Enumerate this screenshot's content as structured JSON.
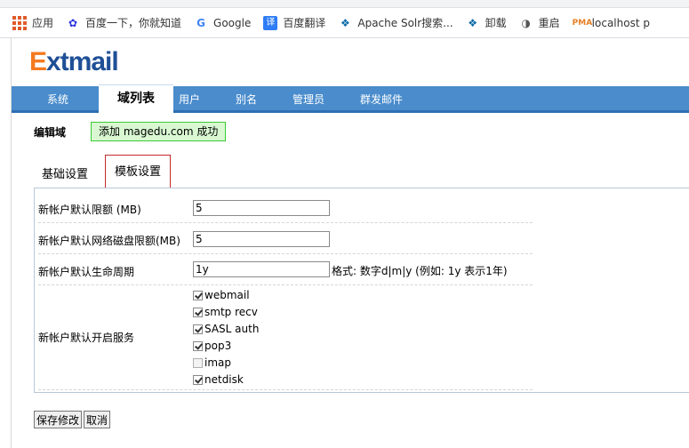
{
  "bookmarks": [
    {
      "icon": "apps-grid-icon",
      "label": "应用"
    },
    {
      "icon": "baidu-paw-icon",
      "label": "百度一下，你就知道"
    },
    {
      "icon": "google-g-icon",
      "label": "Google"
    },
    {
      "icon": "baidu-translate-icon",
      "label": "百度翻译"
    },
    {
      "icon": "drupal-drop-icon",
      "label": "Apache Solr搜索..."
    },
    {
      "icon": "drupal-drop-icon",
      "label": "卸载"
    },
    {
      "icon": "globe-icon",
      "label": "重启"
    },
    {
      "icon": "pma-icon",
      "label": "localhost p"
    }
  ],
  "logo": {
    "e": "E",
    "rest": "xtmail"
  },
  "nav": {
    "items": [
      "系统",
      "域列表",
      "用户",
      "别名",
      "管理员",
      "群发邮件"
    ],
    "active": "域列表"
  },
  "page": {
    "edit_label": "编辑域",
    "message": "添加 magedu.com 成功"
  },
  "tabs": {
    "basic": "基础设置",
    "template": "模板设置"
  },
  "form": {
    "quota_label": "新帐户默认限额 (MB)",
    "quota_value": "5",
    "netdisk_label": "新帐户默认网络磁盘限额(MB)",
    "netdisk_value": "5",
    "lifetime_label": "新帐户默认生命周期",
    "lifetime_value": "1y",
    "lifetime_hint": "格式: 数字d|m|y (例如: 1y 表示1年)",
    "services_label": "新帐户默认开启服务",
    "services": [
      {
        "name": "webmail",
        "checked": true
      },
      {
        "name": "smtp recv",
        "checked": true
      },
      {
        "name": "SASL auth",
        "checked": true
      },
      {
        "name": "pop3",
        "checked": true
      },
      {
        "name": "imap",
        "checked": false
      },
      {
        "name": "netdisk",
        "checked": true
      }
    ]
  },
  "buttons": {
    "save": "保存修改",
    "cancel": "取消"
  },
  "colors": {
    "nav_bg": "#4a8ccc",
    "logo_e": "#f47a20",
    "logo_text": "#1f4f96",
    "success_bg": "#d9f8d2",
    "success_border": "#39cc33",
    "active_tab_border": "#c52a2a"
  }
}
